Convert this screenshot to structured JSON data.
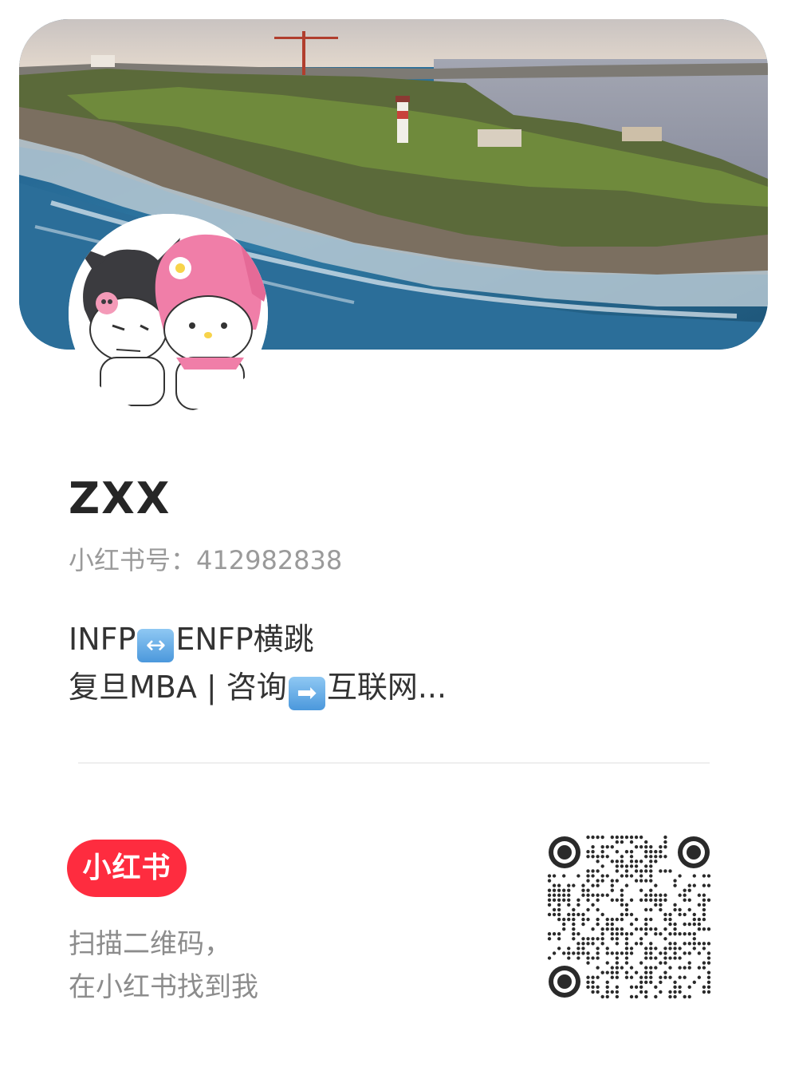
{
  "profile": {
    "name": "ZXX",
    "id_label": "小红书号：",
    "id_value": "412982838",
    "bio_line1_a": "INFP",
    "bio_line1_icon": "↔",
    "bio_line1_b": "ENFP横跳",
    "bio_line2_a": "复旦MBA | 咨询",
    "bio_line2_icon": "➡",
    "bio_line2_b": "互联网..."
  },
  "cover": {
    "image": "coastal-cliff-lighthouse-photo"
  },
  "avatar": {
    "image": "kuromi-and-my-melody-avatar"
  },
  "footer": {
    "brand": "小红书",
    "brand_color": "#fe2c3f",
    "scan_line1": "扫描二维码，",
    "scan_line2": "在小红书找到我"
  },
  "qr": {
    "icon": "qr-code-icon"
  }
}
